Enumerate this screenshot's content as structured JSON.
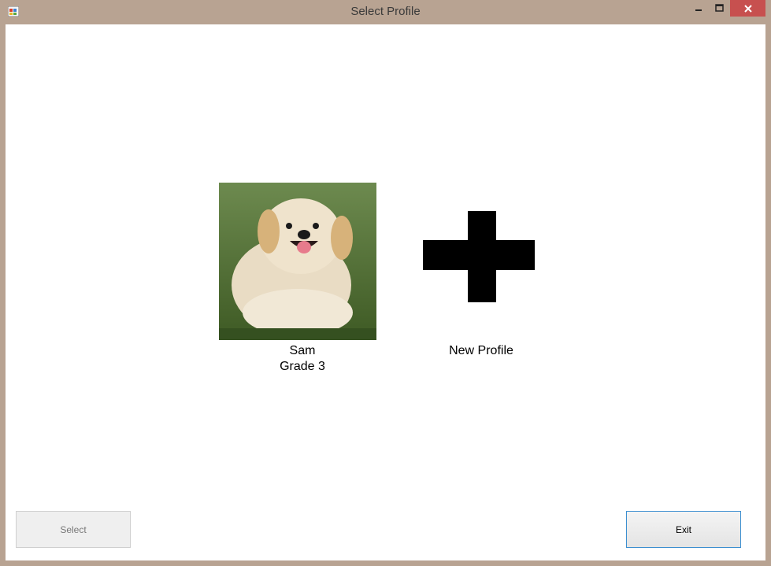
{
  "window": {
    "title": "Select Profile"
  },
  "profiles": [
    {
      "name": "Sam",
      "grade": "Grade 3",
      "icon": "puppy-avatar-icon"
    }
  ],
  "new_profile": {
    "label": "New Profile",
    "icon": "plus-icon"
  },
  "buttons": {
    "select": "Select",
    "exit": "Exit"
  },
  "colors": {
    "frame": "#b8a392",
    "close_button": "#c7504f",
    "focus_border": "#3c8fd0"
  }
}
